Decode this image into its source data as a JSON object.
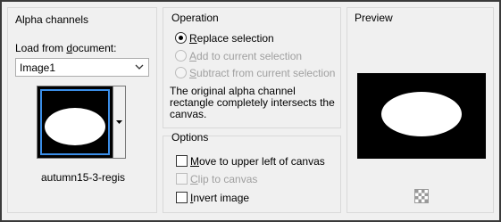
{
  "alpha_channels": {
    "title": "Alpha channels",
    "load_from_label_pre": "Load from ",
    "load_from_label_ul": "d",
    "load_from_label_post": "ocument:",
    "document_value": "Image1",
    "channel_name": "autumn15-3-regis"
  },
  "operation": {
    "title": "Operation",
    "options": [
      {
        "ul": "R",
        "rest": "eplace selection",
        "checked": true,
        "enabled": true
      },
      {
        "ul": "A",
        "rest": "dd to current selection",
        "checked": false,
        "enabled": false
      },
      {
        "ul": "S",
        "rest": "ubtract from current selection",
        "checked": false,
        "enabled": false
      }
    ],
    "message": [
      "The original alpha channel",
      "rectangle completely intersects the",
      "canvas."
    ]
  },
  "options": {
    "title": "Options",
    "items": [
      {
        "ul": "M",
        "rest": "ove to upper left of canvas",
        "checked": false,
        "enabled": true
      },
      {
        "ul": "C",
        "rest": "lip to canvas",
        "checked": false,
        "enabled": false
      },
      {
        "ul": "I",
        "rest": "nvert image",
        "checked": false,
        "enabled": true
      }
    ]
  },
  "preview": {
    "title": "Preview"
  }
}
